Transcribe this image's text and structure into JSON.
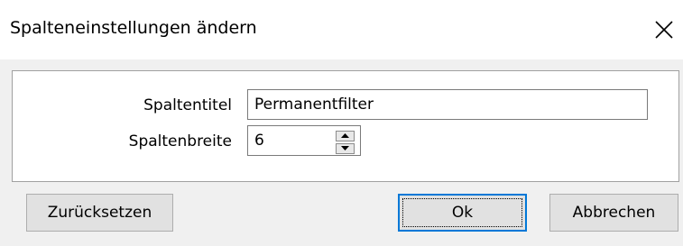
{
  "dialog": {
    "title": "Spalteneinstellungen ändern",
    "close_icon": "close-icon"
  },
  "form": {
    "column_title_label": "Spaltentitel",
    "column_title_value": "Permanentfilter",
    "column_width_label": "Spaltenbreite",
    "column_width_value": "6",
    "spinner_icons": [
      "spin-up-icon",
      "spin-down-icon"
    ]
  },
  "buttons": {
    "reset_label": "Zurücksetzen",
    "ok_label": "Ok",
    "cancel_label": "Abbrechen"
  },
  "colors": {
    "focus_border": "#0078d7",
    "dialog_background": "#f0f0f0",
    "panel_background": "#ffffff"
  }
}
